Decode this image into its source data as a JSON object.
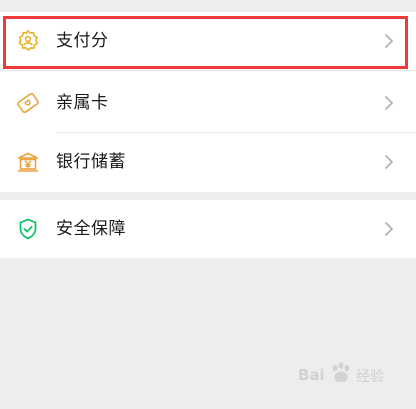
{
  "menu": {
    "groups": [
      {
        "items": [
          {
            "label": "支付分",
            "icon": "payscore-badge-icon",
            "icon_color": "#e6b422"
          },
          {
            "label": "亲属卡",
            "icon": "family-card-icon",
            "icon_color": "#e9a23b"
          },
          {
            "label": "银行储蓄",
            "icon": "bank-deposit-icon",
            "icon_color": "#e9a23b"
          }
        ]
      },
      {
        "items": [
          {
            "label": "安全保障",
            "icon": "security-shield-icon",
            "icon_color": "#07c160"
          }
        ]
      }
    ]
  },
  "highlight": {
    "target": "支付分",
    "color": "#f03a3a"
  },
  "watermark": {
    "brand": "Bai",
    "suffix": "经验"
  }
}
